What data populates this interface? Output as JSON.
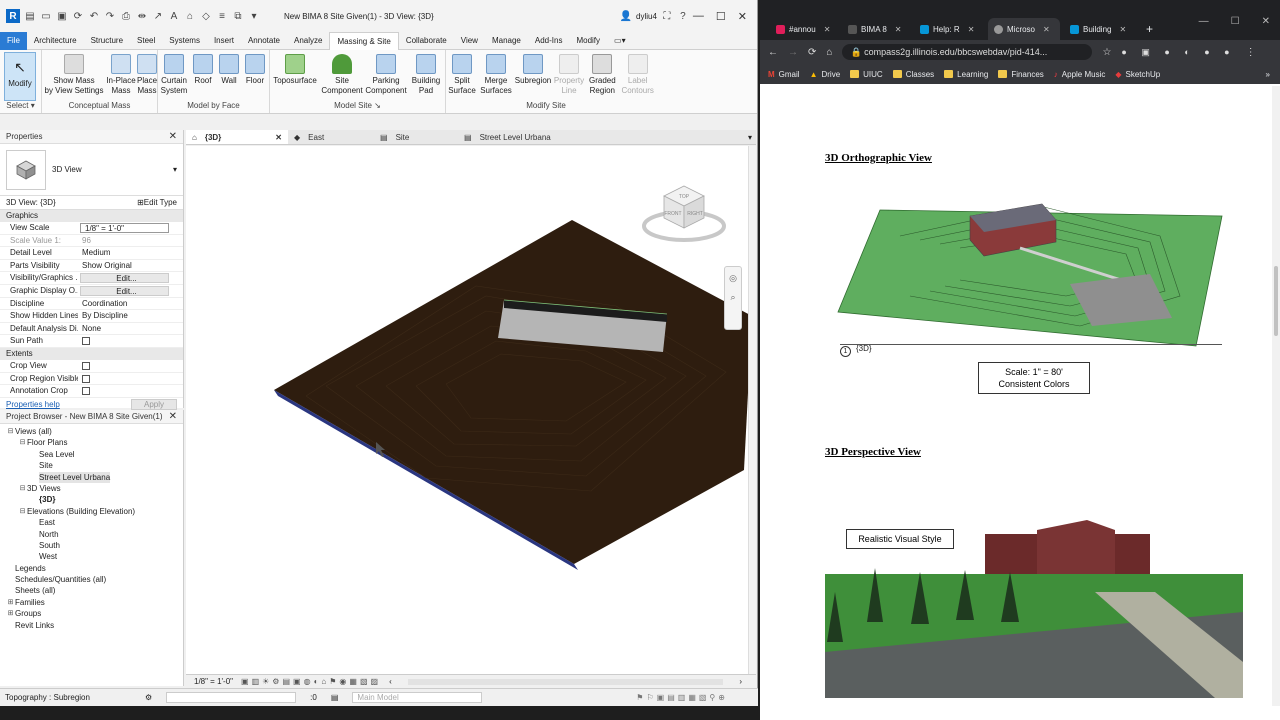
{
  "revit": {
    "title": "New BIMA 8 Site Given(1) - 3D View: {3D}",
    "user": "dyliu4",
    "ribbon_tabs": [
      "File",
      "Architecture",
      "Structure",
      "Steel",
      "Systems",
      "Insert",
      "Annotate",
      "Analyze",
      "Massing & Site",
      "Collaborate",
      "View",
      "Manage",
      "Add-Ins",
      "Modify"
    ],
    "active_tab": "Massing & Site",
    "tools": {
      "modify": "Modify",
      "show_mass": "Show Mass\nby View Settings",
      "inplace_mass": "In-Place\nMass",
      "place_mass": "Place\nMass",
      "curtain_system": "Curtain\nSystem",
      "roof": "Roof",
      "wall": "Wall",
      "floor": "Floor",
      "toposurface": "Toposurface",
      "site_component": "Site\nComponent",
      "parking_component": "Parking\nComponent",
      "building_pad": "Building\nPad",
      "split_surface": "Split\nSurface",
      "merge_surfaces": "Merge\nSurfaces",
      "subregion": "Subregion",
      "property_line": "Property\nLine",
      "graded_region": "Graded\nRegion",
      "label_contours": "Label\nContours"
    },
    "groups": {
      "select": "Select",
      "conceptual_mass": "Conceptual Mass",
      "model_by_face": "Model by Face",
      "model_site": "Model Site",
      "modify_site": "Modify Site"
    },
    "properties": {
      "title": "Properties",
      "type_name": "3D View",
      "instance": "3D View: {3D}",
      "edit_type": "Edit Type",
      "sections": {
        "graphics": "Graphics",
        "extents": "Extents"
      },
      "rows": [
        {
          "k": "View Scale",
          "v": "1/8\" = 1'-0\""
        },
        {
          "k": "Scale Value    1:",
          "v": "96"
        },
        {
          "k": "Detail Level",
          "v": "Medium"
        },
        {
          "k": "Parts Visibility",
          "v": "Show Original"
        },
        {
          "k": "Visibility/Graphics ...",
          "v": "Edit..."
        },
        {
          "k": "Graphic Display O...",
          "v": "Edit..."
        },
        {
          "k": "Discipline",
          "v": "Coordination"
        },
        {
          "k": "Show Hidden Lines",
          "v": "By Discipline"
        },
        {
          "k": "Default Analysis Di...",
          "v": "None"
        },
        {
          "k": "Sun Path",
          "v": ""
        }
      ],
      "extents_rows": [
        "Crop View",
        "Crop Region Visible",
        "Annotation Crop"
      ],
      "help": "Properties help",
      "apply": "Apply"
    },
    "project_browser": {
      "title": "Project Browser - New BIMA 8 Site Given(1)",
      "items": [
        {
          "t": "Views (all)",
          "lvl": 0,
          "tog": "⊟"
        },
        {
          "t": "Floor Plans",
          "lvl": 1,
          "tog": "⊟"
        },
        {
          "t": "Sea Level",
          "lvl": 2,
          "tog": ""
        },
        {
          "t": "Site",
          "lvl": 2,
          "tog": ""
        },
        {
          "t": "Street Level Urbana",
          "lvl": 2,
          "tog": "",
          "sel": true
        },
        {
          "t": "3D Views",
          "lvl": 1,
          "tog": "⊟"
        },
        {
          "t": "{3D}",
          "lvl": 2,
          "tog": "",
          "bold": true
        },
        {
          "t": "Elevations (Building Elevation)",
          "lvl": 1,
          "tog": "⊟"
        },
        {
          "t": "East",
          "lvl": 2,
          "tog": ""
        },
        {
          "t": "North",
          "lvl": 2,
          "tog": ""
        },
        {
          "t": "South",
          "lvl": 2,
          "tog": ""
        },
        {
          "t": "West",
          "lvl": 2,
          "tog": ""
        },
        {
          "t": "Legends",
          "lvl": 0,
          "tog": ""
        },
        {
          "t": "Schedules/Quantities (all)",
          "lvl": 0,
          "tog": ""
        },
        {
          "t": "Sheets (all)",
          "lvl": 0,
          "tog": ""
        },
        {
          "t": "Families",
          "lvl": 0,
          "tog": "⊞"
        },
        {
          "t": "Groups",
          "lvl": 0,
          "tog": "⊞"
        },
        {
          "t": "Revit Links",
          "lvl": 0,
          "tog": ""
        }
      ]
    },
    "view_tabs": [
      {
        "label": "{3D}",
        "active": true
      },
      {
        "label": "East"
      },
      {
        "label": "Site"
      },
      {
        "label": "Street Level Urbana"
      }
    ],
    "viewbar_scale": "1/8\" = 1'-0\"",
    "status_text": "Topography : Subregion",
    "status_zero": ":0",
    "status_model": "Main Model",
    "viewcube": {
      "top": "TOP",
      "front": "FRONT",
      "right": "RIGHT"
    }
  },
  "chrome": {
    "tabs": [
      {
        "label": "#annou",
        "color": "#e01e5a"
      },
      {
        "label": "BIMA 8",
        "color": "#444"
      },
      {
        "label": "Help: R",
        "color": "#0696d7"
      },
      {
        "label": "Microso",
        "color": "#888",
        "active": true
      },
      {
        "label": "Building",
        "color": "#0696d7"
      }
    ],
    "url": "compass2g.illinois.edu/bbcswebdav/pid-414...",
    "bookmarks": [
      "Gmail",
      "Drive",
      "UIUC",
      "Classes",
      "Learning",
      "Finances",
      "Apple Music",
      "SketchUp"
    ],
    "page": {
      "h1": "3D Orthographic View",
      "view_tag": "{3D}",
      "view_num": "1",
      "scale_caption_1": "Scale: 1\" = 80'",
      "scale_caption_2": "Consistent Colors",
      "h2": "3D Perspective View",
      "style_caption": "Realistic Visual Style"
    }
  }
}
